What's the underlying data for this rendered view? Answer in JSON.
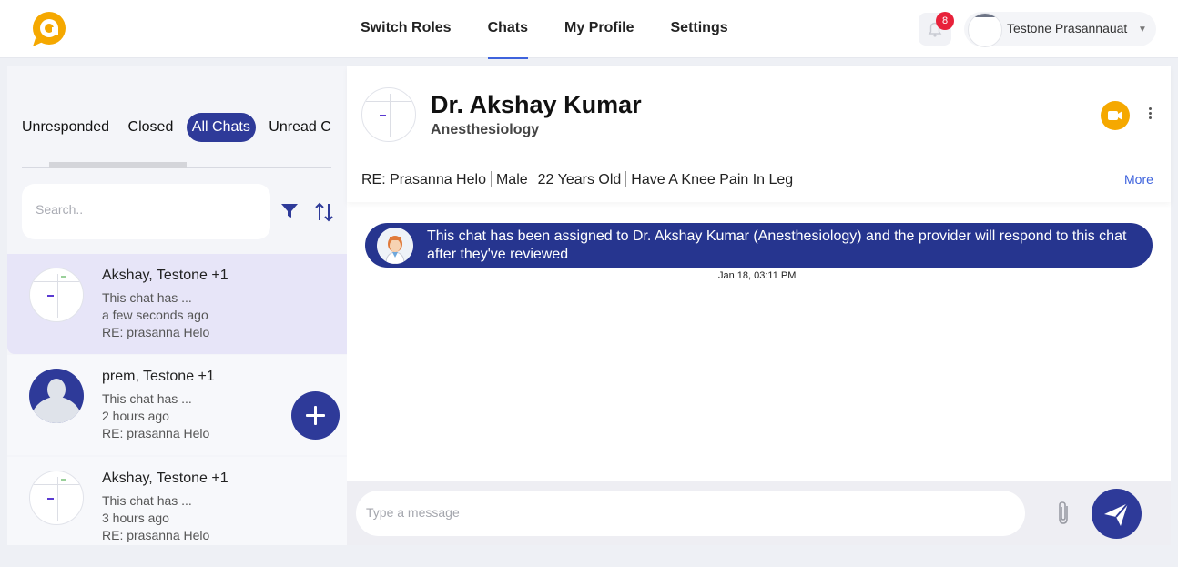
{
  "header": {
    "nav": [
      "Switch Roles",
      "Chats",
      "My Profile",
      "Settings"
    ],
    "active_nav": "Chats",
    "notification_count": "8",
    "user_name": "Testone Prasannauat",
    "brand_color": "#f5a800"
  },
  "sidebar": {
    "tabs": [
      "Unresponded",
      "Closed",
      "All Chats",
      "Unread C"
    ],
    "active_tab": "All Chats",
    "search_placeholder": "Search..",
    "conversations": [
      {
        "name": "Akshay, Testone +1",
        "preview": "This chat has ...",
        "time": "a few seconds ago",
        "subject": "RE: prasanna Helo"
      },
      {
        "name": "prem, Testone +1",
        "preview": "This chat has ...",
        "time": "2 hours ago",
        "subject": "RE: prasanna Helo"
      },
      {
        "name": "Akshay, Testone +1",
        "preview": "This chat has ...",
        "time": "3 hours ago",
        "subject": "RE: prasanna Helo"
      }
    ]
  },
  "chat": {
    "doctor_name": "Dr. Akshay Kumar",
    "specialty": "Anesthesiology",
    "details": [
      "RE: Prasanna Helo",
      "Male",
      "22 Years Old",
      "Have A Knee Pain In Leg"
    ],
    "more_label": "More",
    "system_message": "This chat has been assigned to Dr. Akshay Kumar (Anesthesiology) and the provider will respond to this chat after they've reviewed",
    "system_time": "Jan 18, 03:11 PM",
    "message_placeholder": "Type a message",
    "accent_color": "#2e3a99"
  }
}
